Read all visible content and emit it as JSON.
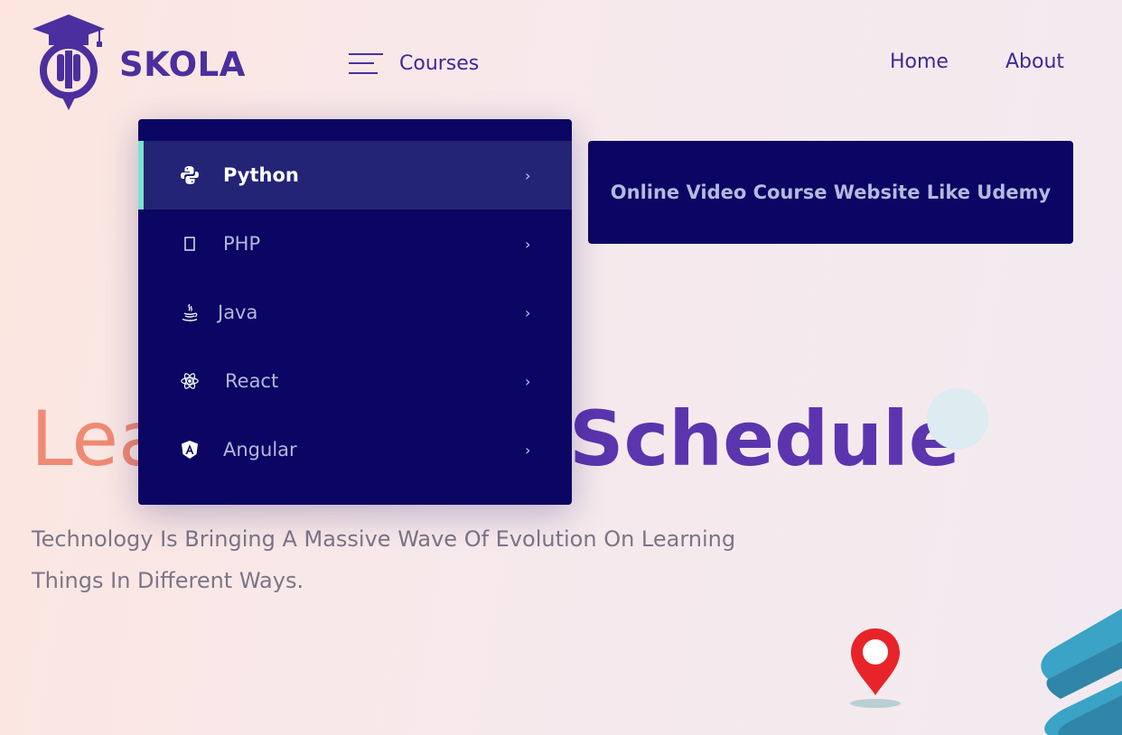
{
  "brand": {
    "name": "SKOLA",
    "color": "#4b2f9e"
  },
  "nav": {
    "courses_label": "Courses",
    "links": [
      {
        "label": "Home"
      },
      {
        "label": "About"
      }
    ]
  },
  "dropdown": {
    "items": [
      {
        "label": "Python",
        "icon": "python-icon",
        "active": true
      },
      {
        "label": "PHP",
        "icon": "php-icon",
        "active": false
      },
      {
        "label": "Java",
        "icon": "java-icon",
        "active": false
      },
      {
        "label": "React",
        "icon": "react-icon",
        "active": false
      },
      {
        "label": "Angular",
        "icon": "angular-icon",
        "active": false
      }
    ],
    "background": "#0b0563",
    "active_accent": "#7be3cc"
  },
  "preview": {
    "text": "Online Video Course Website Like Udemy"
  },
  "hero": {
    "title_start": "Lea",
    "title_end": "Schedule",
    "subtitle_line1": "Technology Is Bringing A Massive Wave Of Evolution On Learning",
    "subtitle_line2": "Things In Different Ways."
  },
  "colors": {
    "title_start": "#ef8a74",
    "title_end": "#5b35ae",
    "pin": "#e8232a",
    "books": "#3aa3c6"
  }
}
